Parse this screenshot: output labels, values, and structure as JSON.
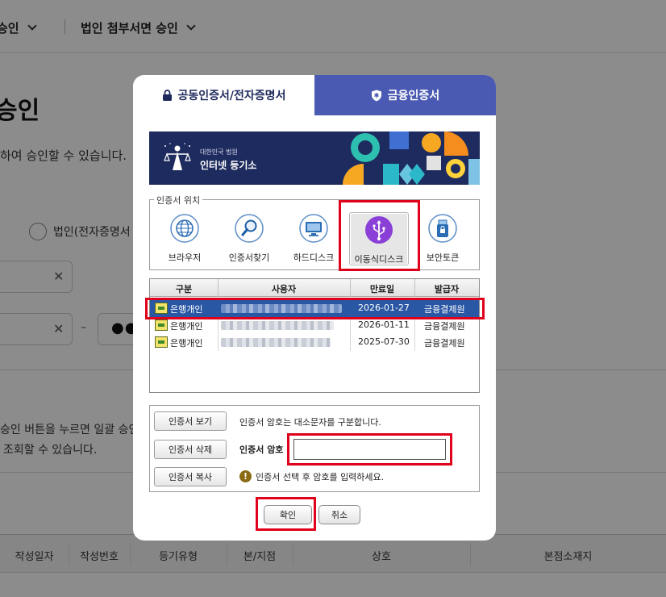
{
  "background": {
    "nav": [
      {
        "label": "승인"
      },
      {
        "label": "법인 첨부서면 승인"
      }
    ],
    "title": "승인",
    "subtitle": "하여 승인할 수 있습니다.",
    "radio_label": "법인(전자증명서",
    "password_mask": "●●",
    "info_line1": "승인 버튼을 누르면 일괄 승인",
    "info_line2": "조회할 수 있습니다.",
    "table_columns": [
      "작성일자",
      "작성번호",
      "등기유형",
      "본/지점",
      "상호",
      "본점소재지"
    ]
  },
  "dialog": {
    "tabs": [
      {
        "label": "공동인증서/전자증명서",
        "icon": "lock-icon",
        "active": true
      },
      {
        "label": "금융인증서",
        "icon": "shield-icon",
        "active": false
      }
    ],
    "banner": {
      "small_text": "대한민국 법원",
      "big_text": "인터넷 등기소"
    },
    "location": {
      "legend": "인증서 위치",
      "items": [
        {
          "label": "브라우저",
          "icon": "globe-icon"
        },
        {
          "label": "인증서찾기",
          "icon": "magnifier-icon"
        },
        {
          "label": "하드디스크",
          "icon": "monitor-icon"
        },
        {
          "label": "이동식디스크",
          "icon": "usb-icon",
          "selected": true
        },
        {
          "label": "보안토큰",
          "icon": "token-icon"
        }
      ]
    },
    "cert_table": {
      "headers": [
        "구분",
        "사용자",
        "만료일",
        "발급자"
      ],
      "rows": [
        {
          "type": "은행개인",
          "user": "",
          "expiry": "2026-01-27",
          "issuer": "금융결제원",
          "selected": true
        },
        {
          "type": "은행개인",
          "user": "",
          "expiry": "2026-01-11",
          "issuer": "금융결제원",
          "selected": false
        },
        {
          "type": "은행개인",
          "user": "",
          "expiry": "2025-07-30",
          "issuer": "금융결제원",
          "selected": false
        }
      ]
    },
    "actions": {
      "view_button": "인증서 보기",
      "view_note": "인증서 암호는 대소문자를 구분합니다.",
      "delete_button": "인증서 삭제",
      "password_label": "인증서 암호",
      "password_value": "",
      "copy_button": "인증서 복사",
      "warning_text": "인증서 선택 후 암호를 입력하세요."
    },
    "ok_button": "확인",
    "cancel_button": "취소"
  },
  "colors": {
    "tab_inactive": "#4a59b2",
    "banner_bg": "#1e2b5e",
    "selected_row": "#2a57a4",
    "highlight_red": "#e0001b"
  }
}
